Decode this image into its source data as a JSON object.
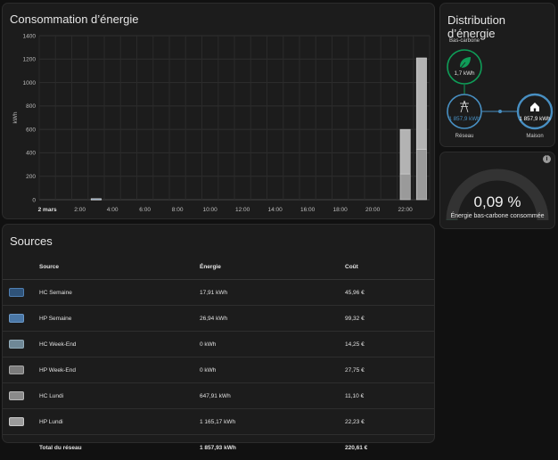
{
  "consumption": {
    "title": "Consommation d’énergie",
    "chart_data": {
      "type": "bar",
      "ylabel": "kWh",
      "ylim": [
        0,
        1400
      ],
      "yticks": [
        "0",
        "200",
        "400",
        "600",
        "800",
        "1000",
        "1200",
        "1400"
      ],
      "xtick_labels": [
        "2 mars",
        "2:00",
        "4:00",
        "6:00",
        "8:00",
        "10:00",
        "12:00",
        "14:00",
        "16:00",
        "18:00",
        "20:00",
        "22:00"
      ],
      "stacked": true,
      "categories": [
        "0h",
        "1h",
        "2h",
        "3h",
        "4h",
        "5h",
        "6h",
        "7h",
        "8h",
        "9h",
        "10h",
        "11h",
        "12h",
        "13h",
        "14h",
        "15h",
        "16h",
        "17h",
        "18h",
        "19h",
        "20h",
        "21h",
        "22h",
        "23h"
      ],
      "series": [
        {
          "name": "HC Semaine",
          "color": "#2e5d8a",
          "values": [
            0,
            0,
            0,
            5,
            0,
            0,
            0,
            0,
            0,
            0,
            0,
            0,
            0,
            0,
            0,
            0,
            0,
            0,
            0,
            0,
            0,
            0,
            0,
            0
          ]
        },
        {
          "name": "HP Semaine",
          "color": "#4f7fb2",
          "values": [
            0,
            0,
            0,
            4,
            0,
            0,
            0,
            0,
            0,
            0,
            0,
            0,
            0,
            0,
            0,
            0,
            0,
            0,
            0,
            0,
            0,
            0,
            0,
            0
          ]
        },
        {
          "name": "HC Week-End",
          "color": "#7f97a8",
          "values": [
            0,
            0,
            0,
            0,
            0,
            0,
            0,
            0,
            0,
            0,
            0,
            0,
            0,
            0,
            0,
            0,
            0,
            0,
            0,
            0,
            0,
            0,
            0,
            0
          ]
        },
        {
          "name": "HP Week-End",
          "color": "#8a8a8a",
          "values": [
            0,
            0,
            0,
            0,
            0,
            0,
            0,
            0,
            0,
            0,
            0,
            0,
            0,
            0,
            0,
            0,
            0,
            0,
            0,
            0,
            0,
            0,
            0,
            0
          ]
        },
        {
          "name": "HC Lundi",
          "color": "#9a9a9a",
          "values": [
            0,
            0,
            0,
            0,
            0,
            0,
            0,
            0,
            0,
            0,
            0,
            0,
            0,
            0,
            0,
            0,
            0,
            0,
            0,
            0,
            0,
            0,
            220,
            430
          ]
        },
        {
          "name": "HP Lundi",
          "color": "#b3b3b3",
          "values": [
            0,
            0,
            0,
            0,
            0,
            0,
            0,
            0,
            0,
            0,
            0,
            0,
            0,
            0,
            0,
            0,
            0,
            0,
            0,
            0,
            0,
            0,
            380,
            780
          ]
        }
      ]
    }
  },
  "sources": {
    "title": "Sources",
    "headers": {
      "source": "Source",
      "energy": "Énergie",
      "cost": "Coût"
    },
    "rows": [
      {
        "name": "HC Semaine",
        "energy": "17,91 kWh",
        "cost": "45,96 €",
        "fill": "#2f5379",
        "border": "#4f7fb2"
      },
      {
        "name": "HP Semaine",
        "energy": "26,94 kWh",
        "cost": "99,32 €",
        "fill": "#4a77a6",
        "border": "#6b98c7"
      },
      {
        "name": "HC Week-End",
        "energy": "0 kWh",
        "cost": "14,25 €",
        "fill": "#6f8896",
        "border": "#93acb9"
      },
      {
        "name": "HP Week-End",
        "energy": "0 kWh",
        "cost": "27,75 €",
        "fill": "#7c7c7c",
        "border": "#a8a8a8"
      },
      {
        "name": "HC Lundi",
        "energy": "647,91 kWh",
        "cost": "11,10 €",
        "fill": "#8a8a8a",
        "border": "#b8b8b8"
      },
      {
        "name": "HP Lundi",
        "energy": "1 165,17 kWh",
        "cost": "22,23 €",
        "fill": "#9b9b9b",
        "border": "#c8c8c8"
      }
    ],
    "total": {
      "label": "Total du réseau",
      "energy": "1 857,93 kWh",
      "cost": "220,61 €"
    }
  },
  "distribution": {
    "title": "Distribution d’énergie",
    "low_carbon": {
      "label": "Bas-carbone",
      "value": "1,7 kWh",
      "color": "#0f9d58",
      "icon": "leaf-icon"
    },
    "grid": {
      "label": "Réseau",
      "value": "1 857,9 kWh",
      "color": "#488fc2",
      "icon": "transmission-tower-icon"
    },
    "home": {
      "label": "Maison",
      "value": "1 857,9 kWh",
      "color": "#488fc2",
      "icon": "home-icon"
    }
  },
  "gauge": {
    "value": "0,09 %",
    "fraction": 0.0009,
    "label": "Énergie bas-carbone consommée",
    "info_icon": "i"
  }
}
